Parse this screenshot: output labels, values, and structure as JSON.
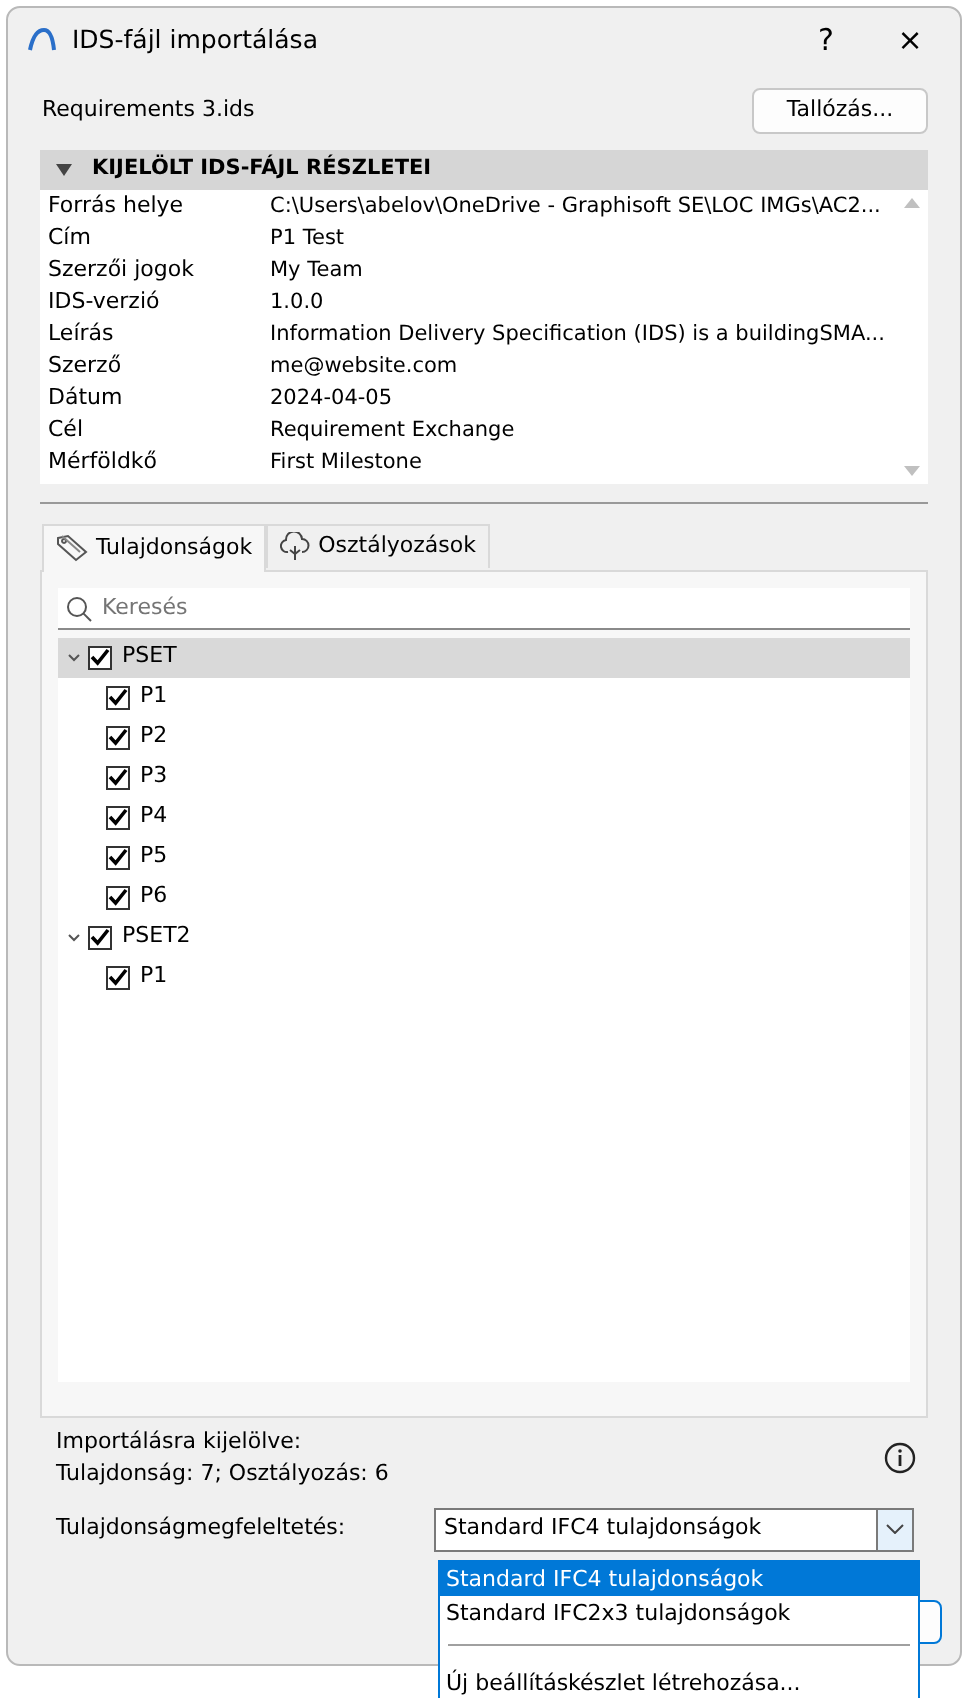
{
  "window": {
    "title": "IDS-fájl importálása",
    "help": "?",
    "close": "×"
  },
  "file_name": "Requirements 3.ids",
  "browse_button": "Tallózás...",
  "details": {
    "title": "KIJELÖLT IDS-FÁJL RÉSZLETEI",
    "expanded": true,
    "rows": [
      {
        "label": "Forrás helye",
        "value": "C:\\Users\\abelov\\OneDrive - Graphisoft SE\\LOC IMGs\\AC2..."
      },
      {
        "label": "Cím",
        "value": "P1 Test"
      },
      {
        "label": "Szerzői jogok",
        "value": "My Team"
      },
      {
        "label": "IDS-verzió",
        "value": "1.0.0"
      },
      {
        "label": "Leírás",
        "value": "Information Delivery Specification (IDS) is a buildingSMA..."
      },
      {
        "label": "Szerző",
        "value": "me@website.com"
      },
      {
        "label": "Dátum",
        "value": "2024-04-05"
      },
      {
        "label": "Cél",
        "value": "Requirement Exchange"
      },
      {
        "label": "Mérföldkő",
        "value": "First Milestone"
      }
    ]
  },
  "tabs": [
    {
      "label": "Tulajdonságok",
      "kind": "tag",
      "selected": true
    },
    {
      "label": "Osztályozások",
      "kind": "tree",
      "selected": false
    }
  ],
  "search": {
    "placeholder": "Keresés"
  },
  "tree": [
    {
      "label": "PSET",
      "checked": true,
      "expanded": true,
      "selected": true,
      "children": [
        {
          "label": "P1",
          "checked": true,
          "selected": false
        },
        {
          "label": "P2",
          "checked": true,
          "selected": false
        },
        {
          "label": "P3",
          "checked": true,
          "selected": false
        },
        {
          "label": "P4",
          "checked": true,
          "selected": false
        },
        {
          "label": "P5",
          "checked": true,
          "selected": false
        },
        {
          "label": "P6",
          "checked": true,
          "selected": false
        }
      ]
    },
    {
      "label": "PSET2",
      "checked": true,
      "expanded": true,
      "selected": false,
      "children": [
        {
          "label": "P1",
          "checked": true,
          "selected": false
        }
      ]
    }
  ],
  "summary": [
    "Importálásra kijelölve:",
    "Tulajdonság: 7; Osztályozás: 6"
  ],
  "mapping": {
    "label": "Tulajdonságmegfeleltetés:",
    "value": "Standard IFC4 tulajdonságok",
    "options": [
      {
        "label": "Standard IFC4 tulajdonságok",
        "kind": "option",
        "selected": true
      },
      {
        "label": "Standard IFC2x3 tulajdonságok",
        "kind": "option",
        "selected": false
      },
      {
        "kind": "divider"
      },
      {
        "label": "Új beállításkészlet létrehozása...",
        "kind": "option",
        "selected": false
      }
    ]
  }
}
